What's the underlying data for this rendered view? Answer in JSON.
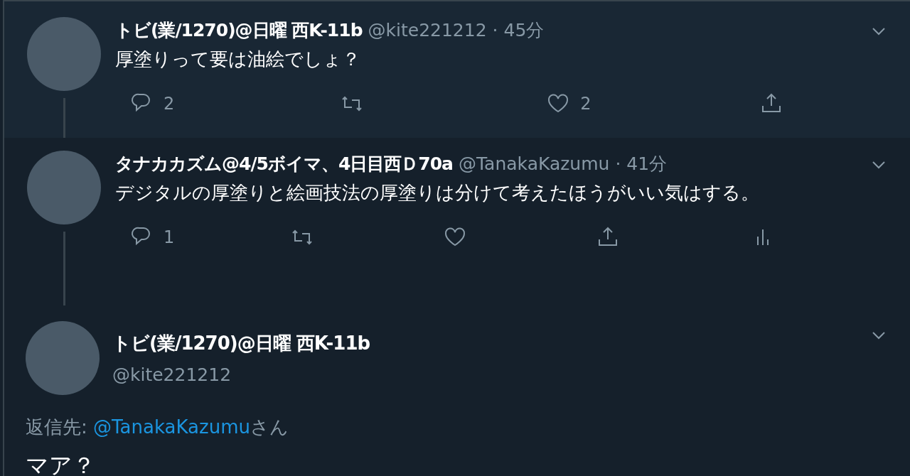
{
  "tweets": [
    {
      "name": "トビ(業/1270)@日曜 西K-11b",
      "handle": "@kite221212",
      "separator": "·",
      "time": "45分",
      "text": "厚塗りって要は油絵でしょ？",
      "actions": [
        {
          "kind": "reply",
          "count": "2"
        },
        {
          "kind": "retweet"
        },
        {
          "kind": "like",
          "count": "2"
        },
        {
          "kind": "share"
        }
      ]
    },
    {
      "name": "タナカカズム@4/5ボイマ、4日目西Ｄ70a",
      "handle": "@TanakaKazumu",
      "separator": "·",
      "time": "41分",
      "text": "デジタルの厚塗りと絵画技法の厚塗りは分けて考えたほうがいい気はする。",
      "actions": [
        {
          "kind": "reply",
          "count": "1"
        },
        {
          "kind": "retweet"
        },
        {
          "kind": "like"
        },
        {
          "kind": "share"
        },
        {
          "kind": "analytics"
        }
      ]
    }
  ],
  "focused": {
    "name": "トビ(業/1270)@日曜 西K-11b",
    "handle": "@kite221212",
    "reply_prefix": "返信先:",
    "reply_to": "@TanakaKazumu",
    "reply_suffix": "さん",
    "text": "マア？"
  }
}
